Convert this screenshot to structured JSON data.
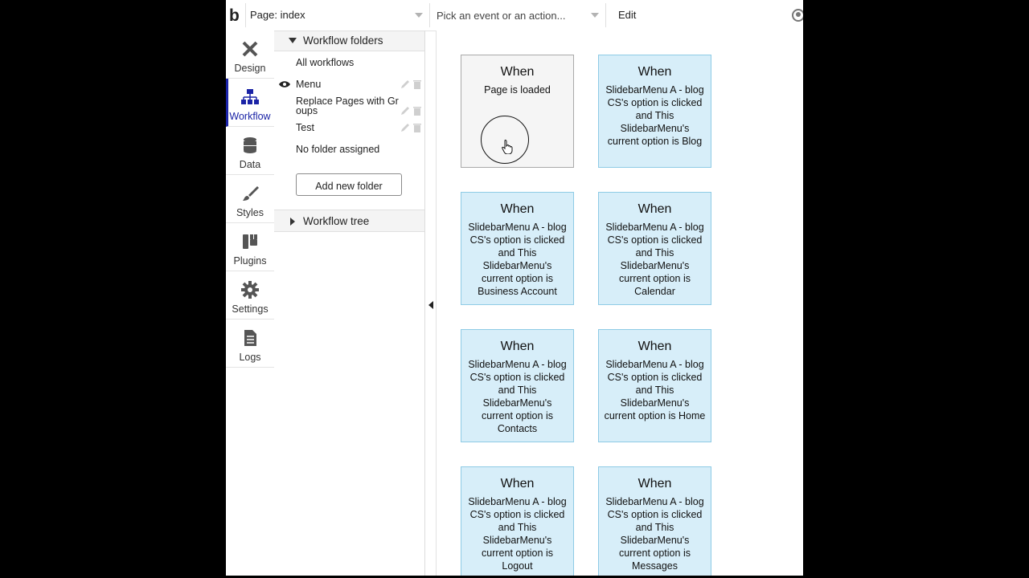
{
  "topbar": {
    "logo": "b",
    "page_select": "Page: index",
    "event_placeholder": "Pick an event or an action...",
    "edit_label": "Edit"
  },
  "nav": {
    "items": [
      {
        "label": "Design",
        "icon": "design-icon"
      },
      {
        "label": "Workflow",
        "icon": "workflow-icon",
        "active": true
      },
      {
        "label": "Data",
        "icon": "database-icon"
      },
      {
        "label": "Styles",
        "icon": "brush-icon"
      },
      {
        "label": "Plugins",
        "icon": "plug-icon"
      },
      {
        "label": "Settings",
        "icon": "gear-icon"
      },
      {
        "label": "Logs",
        "icon": "document-icon"
      }
    ]
  },
  "folders": {
    "header": "Workflow folders",
    "items": [
      {
        "label": "All workflows"
      },
      {
        "label": "Menu",
        "visible_icon": "eye-icon"
      },
      {
        "label": "Replace Pages with Gr oups"
      },
      {
        "label": "Test"
      },
      {
        "label": "No folder assigned"
      }
    ],
    "add_button": "Add new folder",
    "tree_header": "Workflow tree"
  },
  "workflows": [
    {
      "when": "When",
      "desc": "Page is loaded",
      "kind": "page"
    },
    {
      "when": "When",
      "desc": "SlidebarMenu A - blog CS's option is clicked and This SlidebarMenu's current option is Blog"
    },
    {
      "when": "When",
      "desc": "SlidebarMenu A - blog CS's option is clicked and This SlidebarMenu's current option is Business Account"
    },
    {
      "when": "When",
      "desc": "SlidebarMenu A - blog CS's option is clicked and This SlidebarMenu's current option is Calendar"
    },
    {
      "when": "When",
      "desc": "SlidebarMenu A - blog CS's option is clicked and This SlidebarMenu's current option is Contacts"
    },
    {
      "when": "When",
      "desc": "SlidebarMenu A - blog CS's option is clicked and This SlidebarMenu's current option is Home"
    },
    {
      "when": "When",
      "desc": "SlidebarMenu A - blog CS's option is clicked and This SlidebarMenu's current option is Logout"
    },
    {
      "when": "When",
      "desc": "SlidebarMenu A - blog CS's option is clicked and This SlidebarMenu's current option is Messages"
    }
  ],
  "colors": {
    "accent": "#1a23a6",
    "card_fill": "#d7eef9",
    "card_border": "#8ecbe5",
    "page_card_fill": "#f5f5f5"
  }
}
